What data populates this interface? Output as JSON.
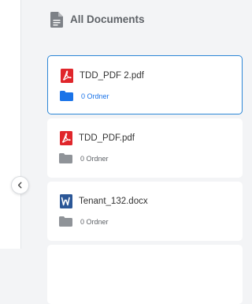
{
  "header": {
    "title": "All Documents"
  },
  "documents": [
    {
      "file_name": "TDD_PDF 2.pdf",
      "file_type_icon": "pdf-file-icon",
      "folder_count": "0 Ordner",
      "selected": true
    },
    {
      "file_name": "TDD_PDF.pdf",
      "file_type_icon": "pdf-file-icon",
      "folder_count": "0 Ordner",
      "selected": false
    },
    {
      "file_name": "Tenant_132.docx",
      "file_type_icon": "word-file-icon",
      "folder_count": "0 Ordner",
      "selected": false
    }
  ],
  "colors": {
    "selected_border": "#2c86d6",
    "selected_folder": "#1a73e8",
    "folder_gray": "#8f9398",
    "pdf_red": "#e0262b",
    "word_blue": "#2b5797"
  },
  "icons": {
    "header": "document-icon",
    "collapse": "chevron-left-icon",
    "folder": "folder-icon"
  }
}
